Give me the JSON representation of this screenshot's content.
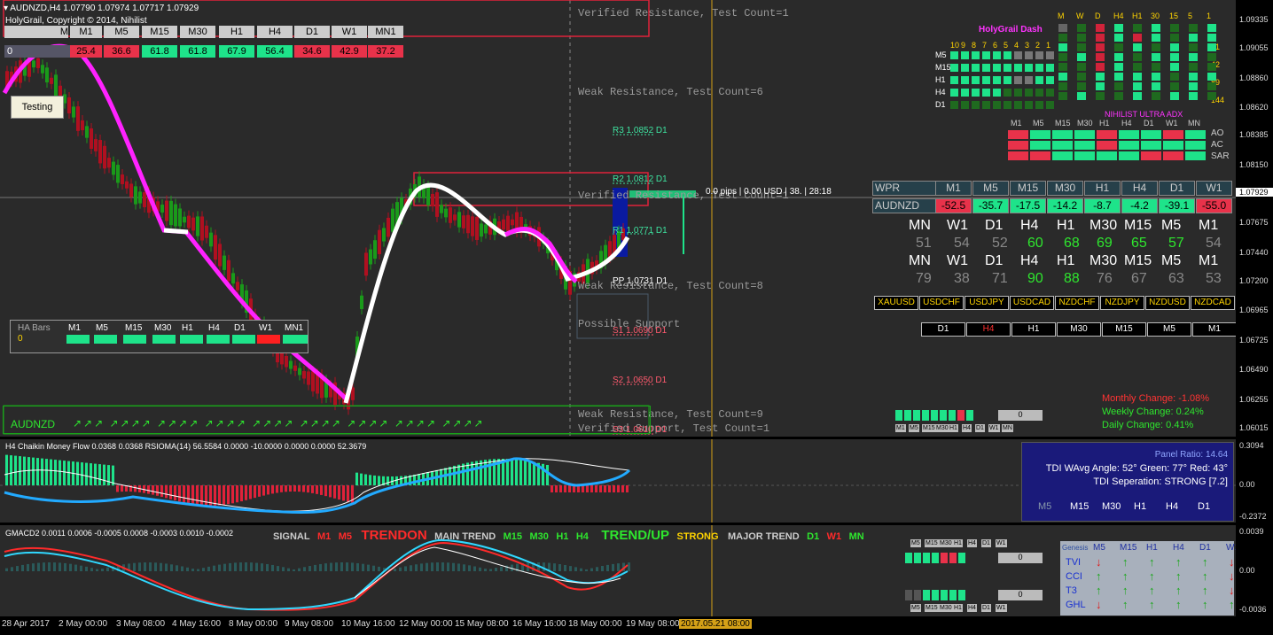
{
  "header": {
    "symbol_line": "AUDNZD,H4  1.07790 1.07974 1.07717 1.07929",
    "copyright": "HolyGrail, Copyright © 2014, Nihilist"
  },
  "tf_row": {
    "first": "M",
    "labels": [
      "M1",
      "M5",
      "M15",
      "M30",
      "H1",
      "H4",
      "D1",
      "W1",
      "MN1"
    ],
    "zero": "0",
    "values": [
      "25.4",
      "36.6",
      "61.8",
      "61.8",
      "67.9",
      "56.4",
      "34.6",
      "42.9",
      "37.2"
    ],
    "colors": [
      "#e8324a",
      "#e8324a",
      "#1ee38a",
      "#1ee38a",
      "#1ee38a",
      "#1ee38a",
      "#e8324a",
      "#e8324a",
      "#e8324a"
    ]
  },
  "testing_button": "Testing",
  "zones": {
    "verified_res_top": "Verified Resistance, Test Count=1",
    "weak_res_6": "Weak Resistance, Test Count=6",
    "verified_mid": "Verified Resistance, Test Count=1",
    "weak_res_8": "Weak Resistance, Test Count=8",
    "possible_support": "Possible Support",
    "weak_res_9": "Weak Resistance, Test Count=9",
    "verified_support": "Verified Support, Test Count=1"
  },
  "pivots": {
    "r3": "R3 1.0852 D1",
    "r2": "R2 1.0812 D1",
    "r1": "R1 1.0771 D1",
    "pp": "PP 1.0731 D1",
    "s1": "S1 1.0690 D1",
    "s2": "S2 1.0650 D1",
    "s3": "S3 1.0610 D1"
  },
  "pips_info": "0.0 pips | 0.00 USD | 38. | 28:18",
  "ha_bars": {
    "title": "HA Bars",
    "value": "0",
    "labels": [
      "M1",
      "M5",
      "M15",
      "M30",
      "H1",
      "H4",
      "D1",
      "W1",
      "MN1"
    ]
  },
  "trend_row": {
    "symbol": "AUDNZD",
    "arrows": "↗↗↗  ↗↗↗↗  ↗↗↗↗  ↗↗↗↗  ↗↗↗↗  ↗↗↗↗  ↗↗↗↗  ↗↗↗↗  ↗↗↗↗"
  },
  "holygrail": {
    "title": "HolyGrail Dash",
    "col_heads": [
      "M",
      "W",
      "D",
      "H4",
      "H1",
      "30",
      "15",
      "5",
      "1"
    ],
    "nums_top": [
      "10",
      "9",
      "8",
      "7",
      "6",
      "5",
      "4",
      "3",
      "2",
      "1"
    ],
    "row_labels": [
      "M5",
      "M15",
      "H1",
      "H4",
      "D1"
    ],
    "right_nums": [
      "7",
      "21",
      "42",
      "89",
      "144"
    ]
  },
  "adx": {
    "title": "NIHILIST ULTRA ADX",
    "col_heads": [
      "M1",
      "M5",
      "M15",
      "M30",
      "H1",
      "H4",
      "D1",
      "W1",
      "MN"
    ],
    "rows": [
      "AO",
      "AC",
      "SAR"
    ]
  },
  "wpr": {
    "title": "WPR",
    "symbol": "AUDNZD",
    "labels": [
      "M1",
      "M5",
      "M15",
      "M30",
      "H1",
      "H4",
      "D1",
      "W1"
    ],
    "values": [
      "-52.5",
      "-35.7",
      "-17.5",
      "-14.2",
      "-8.7",
      "-4.2",
      "-39.1",
      "-55.0"
    ]
  },
  "strength": {
    "tfs": [
      "MN",
      "W1",
      "D1",
      "H4",
      "H1",
      "M30",
      "M15",
      "M5",
      "M1"
    ],
    "row1": [
      "51",
      "54",
      "52",
      "60",
      "68",
      "69",
      "65",
      "57",
      "54"
    ],
    "row2": [
      "79",
      "38",
      "71",
      "90",
      "88",
      "76",
      "67",
      "63",
      "53"
    ]
  },
  "pairs": [
    "XAUUSD",
    "USDCHF",
    "USDJPY",
    "USDCAD",
    "NZDCHF",
    "NZDJPY",
    "NZDUSD",
    "NZDCAD"
  ],
  "tf_bottom": [
    "D1",
    "H4",
    "H1",
    "M30",
    "M15",
    "M5",
    "M1"
  ],
  "changes": {
    "monthly": "Monthly Change: -1.08%",
    "weekly": "Weekly Change: 0.24%",
    "daily": "Daily Change: 0.41%"
  },
  "mini_panel": {
    "value": "0",
    "labels": [
      "M1",
      "M5",
      "M15",
      "M30",
      "H1",
      "H4",
      "D1",
      "W1",
      "MN"
    ]
  },
  "price_axis": [
    "1.09335",
    "1.09055",
    "1.08860",
    "1.08620",
    "1.08385",
    "1.08150",
    "1.07929",
    "1.07675",
    "1.07440",
    "1.07200",
    "1.06965",
    "1.06725",
    "1.06490",
    "1.06255",
    "1.06015"
  ],
  "current_price": "1.07929",
  "ind1": {
    "title": "H4 Chaikin Money Flow 0.0368 0.0368  RSIOMA(14) 56.5584 0.0000 -10.0000 0.0000 0.0000 52.3679",
    "axis": [
      "0.3094",
      "0.00",
      "-0.2372"
    ]
  },
  "tdi": {
    "ratio": "Panel Ratio: 14.64",
    "wavg": "TDI WAvg Angle: 52°  Green: 77°  Red: 43°",
    "sep": "TDI Seperation: STRONG [7.2]",
    "tfs": [
      "M5",
      "M15",
      "M30",
      "H1",
      "H4",
      "D1"
    ]
  },
  "ind2": {
    "title": "GMACD2 0.0011 0.0006 -0.0005 0.0008 -0.0003 0.0010 -0.0002",
    "signal": "SIGNAL",
    "m1": "M1",
    "m5": "M5",
    "trendon": "TRENDON",
    "main": "MAIN TREND",
    "m15": "M15",
    "m30": "M30",
    "h1": "H1",
    "h4": "H4",
    "trendup": "TREND/UP",
    "strong": "STRONG",
    "major": "MAJOR TREND",
    "d1": "D1",
    "w1": "W1",
    "mn": "MN",
    "axis": [
      "0.0039",
      "0.00",
      "-0.0036"
    ]
  },
  "mini2": {
    "labels": [
      "M5",
      "M15",
      "M30",
      "H1",
      "H4",
      "D1",
      "W1"
    ],
    "value": "0"
  },
  "genesis": {
    "title": "Genesis",
    "tfs": [
      "M5",
      "M15",
      "H1",
      "H4",
      "D1",
      "W1"
    ],
    "rows": [
      {
        "name": "TVI",
        "v": [
          "dn",
          "up",
          "up",
          "up",
          "up",
          "dn"
        ]
      },
      {
        "name": "CCI",
        "v": [
          "up",
          "up",
          "up",
          "up",
          "up",
          "dn"
        ]
      },
      {
        "name": "T3",
        "v": [
          "up",
          "up",
          "up",
          "up",
          "up",
          "dn"
        ]
      },
      {
        "name": "GHL",
        "v": [
          "dn",
          "up",
          "up",
          "up",
          "up",
          "up"
        ]
      }
    ]
  },
  "time_axis": [
    "28 Apr 2017",
    "2 May 00:00",
    "3 May 08:00",
    "4 May 16:00",
    "8 May 00:00",
    "9 May 08:00",
    "10 May 16:00",
    "12 May 00:00",
    "15 May 08:00",
    "16 May 16:00",
    "18 May 00:00",
    "19 May 08:00"
  ],
  "time_marker": "2017.05.21 08:00"
}
